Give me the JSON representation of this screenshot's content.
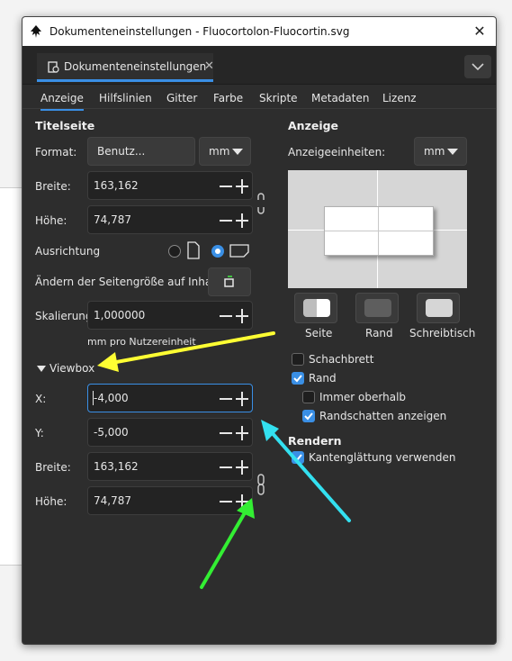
{
  "window": {
    "title": "Dokumenteneinstellungen - Fluocortolon-Fluocortin.svg",
    "close_glyph": "✕"
  },
  "doc_tab": {
    "label": "Dokumenteneinstellungen",
    "close_glyph": "✕"
  },
  "subtabs": [
    "Anzeige",
    "Hilfslinien",
    "Gitter",
    "Farbe",
    "Skripte",
    "Metadaten",
    "Lizenz"
  ],
  "active_subtab": "Anzeige",
  "titelseite": {
    "heading": "Titelseite",
    "format_label": "Format:",
    "format_value": "Benutz...",
    "unit_value": "mm",
    "breite_label": "Breite:",
    "breite_value": "163,162",
    "hoehe_label": "Höhe:",
    "hoehe_value": "74,787",
    "ausrichtung_label": "Ausrichtung",
    "orientation_selected": "landscape",
    "resize_label": "Ändern der Seitengröße auf Inhalt:",
    "skalierung_label": "Skalierung:",
    "skalierung_value": "1,000000",
    "unit_note": "mm pro Nutzereinheit"
  },
  "viewbox": {
    "heading": "Viewbox",
    "x_label": "X:",
    "x_value": "-4,000",
    "y_label": "Y:",
    "y_value": "-5,000",
    "breite_label": "Breite:",
    "breite_value": "163,162",
    "hoehe_label": "Höhe:",
    "hoehe_value": "74,787"
  },
  "anzeige": {
    "heading": "Anzeige",
    "units_label": "Anzeigeeinheiten:",
    "units_value": "mm",
    "swatches": [
      {
        "label": "Seite",
        "color": "#ffffff"
      },
      {
        "label": "Rand",
        "color": "#5e5e5e"
      },
      {
        "label": "Schreibtisch",
        "color": "#d6d6d6"
      }
    ],
    "options": [
      {
        "label": "Schachbrett",
        "checked": false
      },
      {
        "label": "Rand",
        "checked": true
      },
      {
        "label": "Immer oberhalb",
        "checked": false
      },
      {
        "label": "Randschatten anzeigen",
        "checked": true
      }
    ]
  },
  "rendern": {
    "heading": "Rendern",
    "options": [
      {
        "label": "Kantenglättung verwenden",
        "checked": true
      }
    ]
  },
  "colors": {
    "accent": "#3a8fe5",
    "arrow_yellow": "#ffff33",
    "arrow_cyan": "#33e0f0",
    "arrow_green": "#33ee33"
  }
}
